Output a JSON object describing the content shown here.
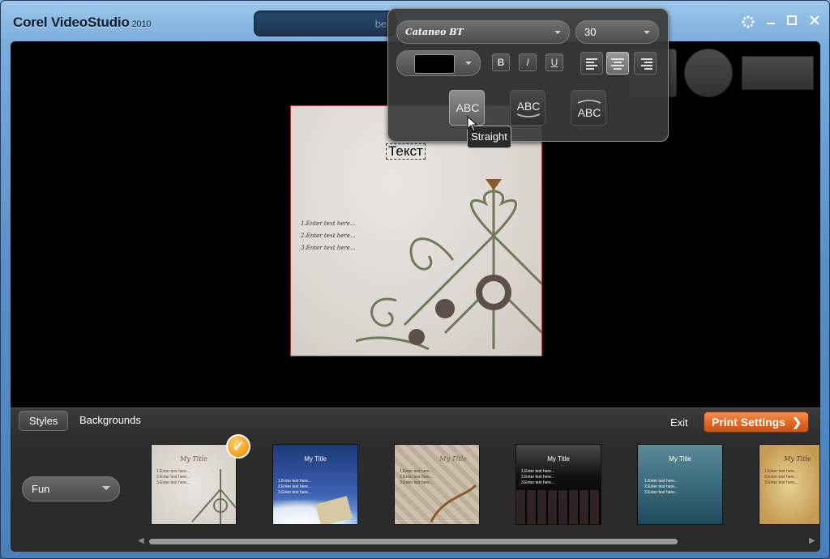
{
  "app": {
    "name": "Corel VideoStudio",
    "version": "2010"
  },
  "title_box": {
    "text": "bel"
  },
  "window_controls": {
    "settings": "settings-icon",
    "minimize": "minimize-icon",
    "maximize": "maximize-icon",
    "close": "close-icon"
  },
  "canvas": {
    "heading": "Текст",
    "lines": [
      "1.Enter text here...",
      "2.Enter text here...",
      "3.Enter text here..."
    ],
    "frame_color": "#b23a3a"
  },
  "text_panel": {
    "font": "Cataneo BT",
    "size": "30",
    "color": "#000000",
    "bold_label": "B",
    "italic_label": "I",
    "underline_label": "U",
    "alignment": "center",
    "shapes": [
      {
        "label": "ABC"
      },
      {
        "label": "ABC"
      },
      {
        "label": "ABC"
      }
    ],
    "tooltip": "Straight"
  },
  "bottom": {
    "tabs": [
      {
        "label": "Styles"
      },
      {
        "label": "Backgrounds"
      }
    ],
    "exit_label": "Exit",
    "print_settings_label": "Print Settings",
    "style_category": "Fun",
    "thumbnails": [
      {
        "title": "My Title",
        "lines": [
          "1.Enter text here...",
          "2.Enter text here...",
          "3.Enter text here..."
        ],
        "selected": true
      },
      {
        "title": "My Title",
        "lines": [
          "1.Enter text here...",
          "2.Enter text here...",
          "3.Enter text here..."
        ],
        "selected": false
      },
      {
        "title": "My Title",
        "lines": [
          "1.Enter text here...",
          "2.Enter text here...",
          "3.Enter text here..."
        ],
        "selected": false
      },
      {
        "title": "My Title",
        "lines": [
          "1.Enter text here...",
          "2.Enter text here...",
          "3.Enter text here..."
        ],
        "selected": false
      },
      {
        "title": "My Title",
        "lines": [
          "1.Enter text here...",
          "2.Enter text here...",
          "3.Enter text here..."
        ],
        "selected": false
      },
      {
        "title": "My Title",
        "lines": [
          "1.Enter text here...",
          "2.Enter text here...",
          "3.Enter text here..."
        ],
        "selected": false
      }
    ]
  },
  "colors": {
    "accent": "#e26a24",
    "window_blue": "#4a7fba"
  }
}
